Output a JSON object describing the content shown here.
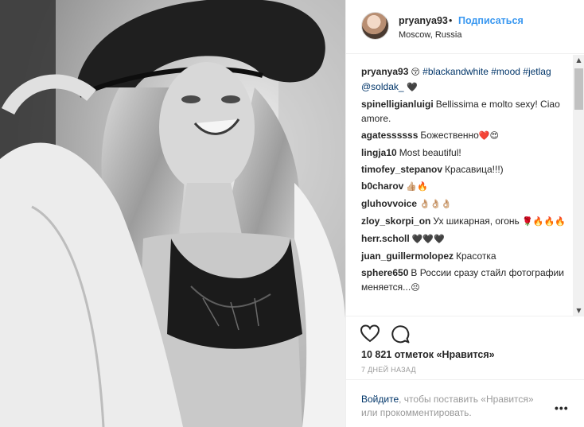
{
  "post": {
    "photo_alt": "black and white portrait photo",
    "user": "pryanya93",
    "dot": "•",
    "follow_label": "Подписаться",
    "location": "Moscow, Russia"
  },
  "comments": [
    {
      "user": "pryanya93",
      "parts": [
        {
          "type": "emoji",
          "text": "😚"
        },
        {
          "type": "tag",
          "text": " #blackandwhite"
        },
        {
          "type": "tag",
          "text": " #mood"
        },
        {
          "type": "tag",
          "text": " #jetlag"
        },
        {
          "type": "tag",
          "text": " @soldak_"
        },
        {
          "type": "emoji",
          "text": " 🖤"
        }
      ]
    },
    {
      "user": "spinelligianluigi",
      "parts": [
        {
          "type": "text",
          "text": "Bellissima e molto sexy! Ciao amore."
        }
      ]
    },
    {
      "user": "agatessssss",
      "parts": [
        {
          "type": "text",
          "text": "Божественно"
        },
        {
          "type": "emoji",
          "text": "❤️😍"
        }
      ]
    },
    {
      "user": "lingja10",
      "parts": [
        {
          "type": "text",
          "text": "Most beautiful!"
        }
      ]
    },
    {
      "user": "timofey_stepanov",
      "parts": [
        {
          "type": "text",
          "text": "Красавица!!!)"
        }
      ]
    },
    {
      "user": "b0charov",
      "parts": [
        {
          "type": "emoji",
          "text": "👍🏼🔥"
        }
      ]
    },
    {
      "user": "gluhovvoice",
      "parts": [
        {
          "type": "emoji",
          "text": "👌🏼👌🏼👌🏼"
        }
      ]
    },
    {
      "user": "zloy_skorpi_on",
      "parts": [
        {
          "type": "text",
          "text": "Ух шикарная, огонь "
        },
        {
          "type": "emoji",
          "text": "🌹🔥🔥🔥"
        }
      ]
    },
    {
      "user": "herr.scholl",
      "parts": [
        {
          "type": "emoji",
          "text": "🖤🖤🖤"
        }
      ]
    },
    {
      "user": "juan_guillermolopez",
      "parts": [
        {
          "type": "text",
          "text": "Красотка"
        }
      ]
    },
    {
      "user": "sphere650",
      "parts": [
        {
          "type": "text",
          "text": "В России сразу стайл фотографии меняется..."
        },
        {
          "type": "emoji",
          "text": "😣"
        }
      ]
    }
  ],
  "scrollbar": {
    "up": "▲",
    "down": "▼"
  },
  "actions": {
    "likes": "10 821 отметок «Нравится»",
    "date": "7 ДНЕЙ НАЗАД"
  },
  "footer": {
    "login": "Войдите",
    "rest": ", чтобы поставить «Нравится» или прокомментировать.",
    "more": "•••"
  },
  "icons": {
    "heart": "heart-icon",
    "comment": "comment-bubble-icon",
    "more": "more-options-icon"
  },
  "colors": {
    "link_blue": "#3897f0",
    "tag_blue": "#003569",
    "text": "#262626",
    "muted": "#999999"
  }
}
